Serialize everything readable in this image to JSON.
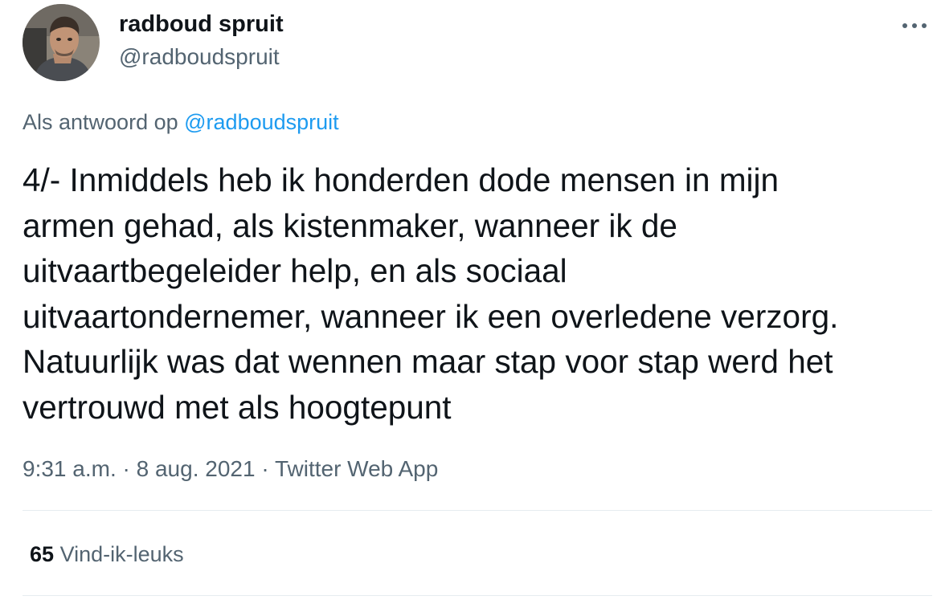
{
  "author": {
    "display_name": "radboud spruit",
    "handle": "@radboudspruit",
    "avatar_icon": "user-avatar"
  },
  "header": {
    "more_icon": "more-horizontal-icon"
  },
  "reply": {
    "prefix": "Als antwoord op",
    "mention": "@radboudspruit"
  },
  "tweet": {
    "text": "4/- Inmiddels heb ik honderden dode mensen in mijn\narmen gehad, als kistenmaker, wanneer ik de\nuitvaartbegeleider help, en als sociaal\nuitvaartondernemer, wanneer ik een overledene verzorg.\nNatuurlijk was dat wennen maar stap voor stap werd het\nvertrouwd met als hoogtepunt"
  },
  "meta": {
    "time": "9:31 a.m.",
    "separator1": " · ",
    "date": "8 aug. 2021",
    "separator2": " · ",
    "source": "Twitter Web App"
  },
  "stats": {
    "likes_count": "65",
    "likes_label": "Vind-ik-leuks"
  },
  "colors": {
    "text_primary": "#0f1419",
    "text_secondary": "#536471",
    "link": "#1d9bf0",
    "divider": "#e6ecf0"
  }
}
